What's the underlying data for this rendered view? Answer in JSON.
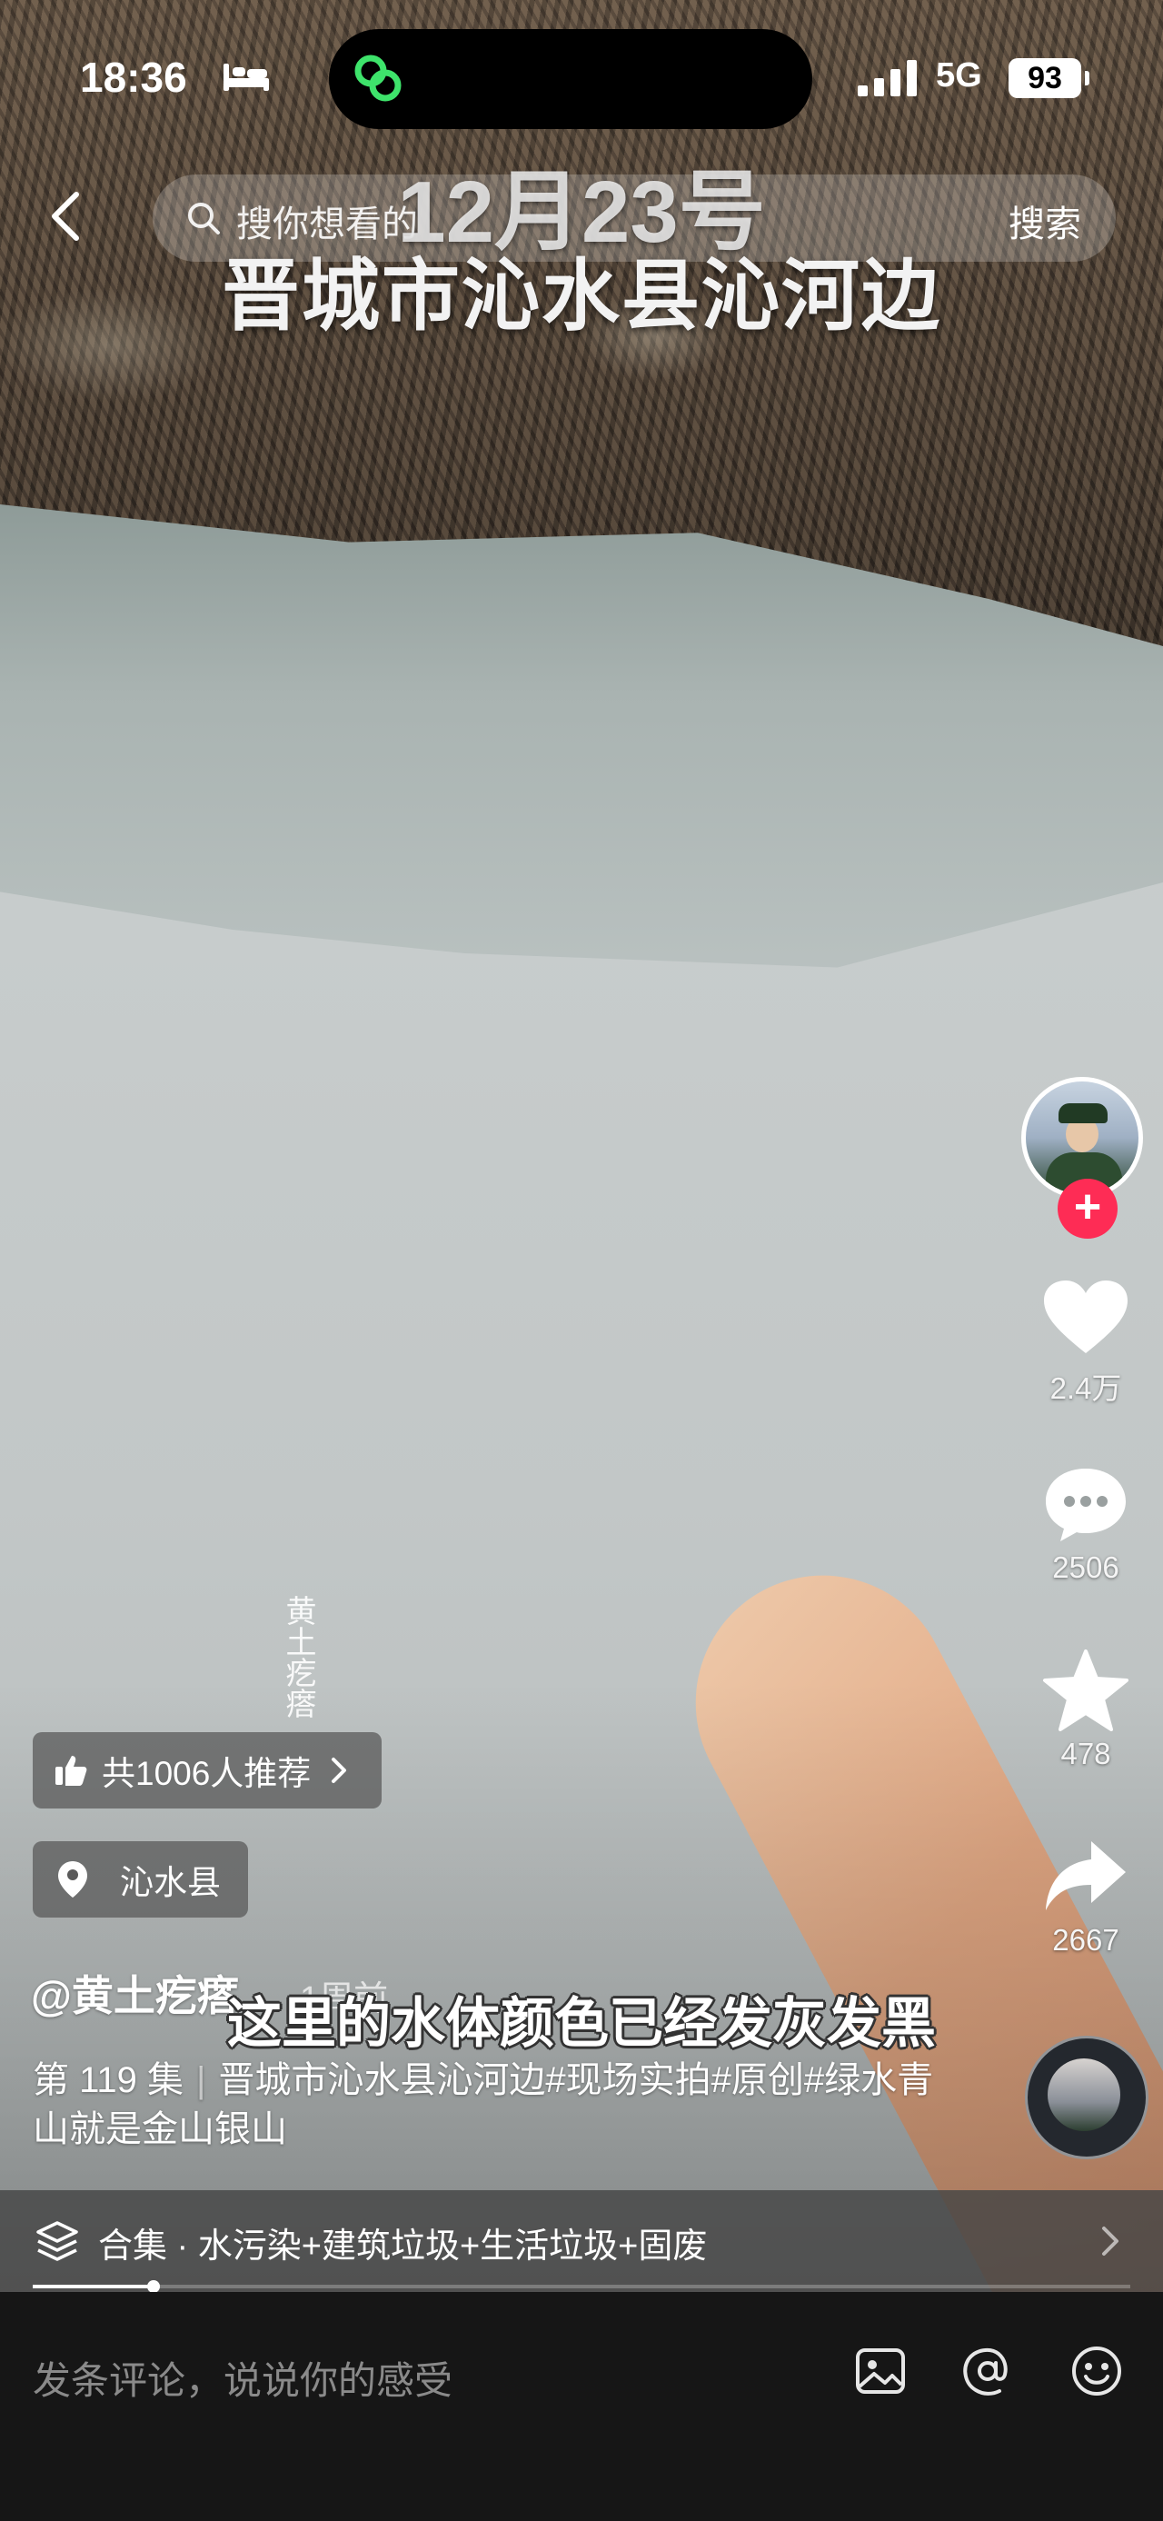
{
  "status_bar": {
    "time": "18:36",
    "network": "5G",
    "battery": "93"
  },
  "search": {
    "placeholder": "搜你想看的",
    "button_label": "搜索"
  },
  "video_overlay": {
    "date": "12月23号",
    "place": "晋城市沁水县沁河边",
    "watermark": "黄土疙瘩",
    "subtitle": "这里的水体颜色已经发灰发黑"
  },
  "actions": {
    "likes": "2.4万",
    "comments": "2506",
    "favorites": "478",
    "shares": "2667"
  },
  "recommend": {
    "label": "共1006人推荐"
  },
  "location": {
    "label": "沁水县"
  },
  "author": {
    "handle": "@黄土疙瘩",
    "ago": "1周前"
  },
  "description": {
    "episode": "第 119 集",
    "text": "晋城市沁水县沁河边#现场实拍#原创#绿水青山就是金山银山"
  },
  "collection": {
    "label": "合集 · 水污染+建筑垃圾+生活垃圾+固废"
  },
  "playback": {
    "progress_fraction": 0.11
  },
  "comment": {
    "placeholder": "发条评论，说说你的感受"
  },
  "colors": {
    "follow_accent": "#fe2c55",
    "comment_bar_bg": "#161616"
  }
}
